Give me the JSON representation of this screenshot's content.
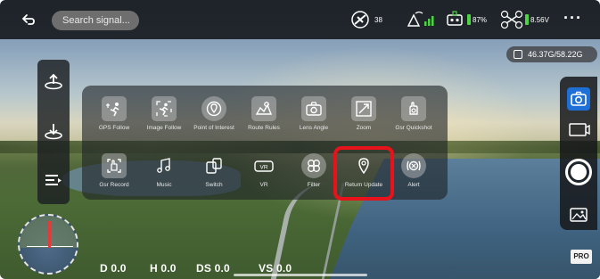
{
  "topbar": {
    "back_icon": "back-arrow-icon",
    "search_placeholder": "Search signal...",
    "gps_count": "38",
    "remote_battery": "87%",
    "drone_voltage": "8.56V",
    "more_icon": "more-dots-icon"
  },
  "storage": {
    "text": "46.37G/58.22G",
    "icon": "sd-card-icon"
  },
  "left_panel": [
    "takeoff-icon",
    "landing-icon",
    "menu-list-icon"
  ],
  "menu": {
    "row1": [
      {
        "label": "GPS Follow",
        "icon": "gps-follow-icon"
      },
      {
        "label": "Image Follow",
        "icon": "image-follow-icon"
      },
      {
        "label": "Point of Interest",
        "icon": "point-of-interest-icon"
      },
      {
        "label": "Route Rules",
        "icon": "route-rules-icon"
      },
      {
        "label": "Lens Angle",
        "icon": "lens-angle-icon"
      },
      {
        "label": "Zoom",
        "icon": "zoom-icon"
      },
      {
        "label": "Gsr Quickshot",
        "icon": "quickshot-icon"
      }
    ],
    "row2": [
      {
        "label": "Gsr Record",
        "icon": "gesture-record-icon"
      },
      {
        "label": "Music",
        "icon": "music-icon"
      },
      {
        "label": "Switch",
        "icon": "switch-icon"
      },
      {
        "label": "VR",
        "icon": "vr-icon"
      },
      {
        "label": "Filter",
        "icon": "filter-icon"
      },
      {
        "label": "Return Update",
        "icon": "return-location-icon"
      },
      {
        "label": "Alert",
        "icon": "alert-icon"
      }
    ],
    "vr_badge": "VR"
  },
  "telemetry": {
    "d": "D 0.0",
    "h": "H 0.0",
    "ds": "DS 0.0",
    "vs": "VS 0.0"
  },
  "right_panel": [
    "photo-mode-icon",
    "video-mode-icon",
    "shutter-button",
    "gallery-icon"
  ],
  "pro_label": "PRO"
}
